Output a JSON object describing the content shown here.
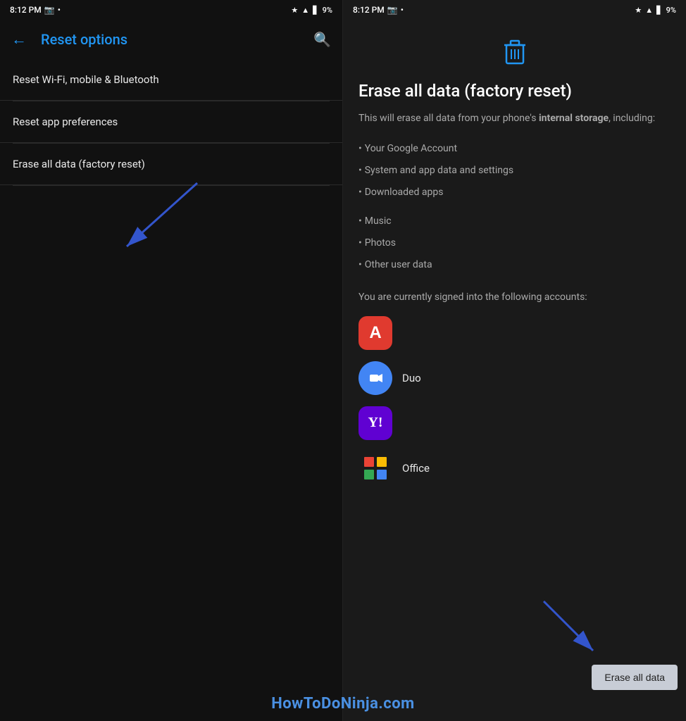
{
  "left_screen": {
    "status_bar": {
      "time": "8:12 PM",
      "battery": "9%"
    },
    "toolbar": {
      "back_label": "←",
      "title": "Reset options",
      "search_label": "🔍"
    },
    "menu_items": [
      {
        "id": "wifi-reset",
        "label": "Reset Wi-Fi, mobile & Bluetooth"
      },
      {
        "id": "app-prefs",
        "label": "Reset app preferences"
      },
      {
        "id": "factory-reset",
        "label": "Erase all data (factory reset)"
      }
    ]
  },
  "right_screen": {
    "status_bar": {
      "time": "8:12 PM",
      "battery": "9%"
    },
    "content": {
      "title": "Erase all data (factory reset)",
      "description_prefix": "This will erase all data from your phone's ",
      "description_bold": "internal storage",
      "description_suffix": ", including:",
      "bullet_items": [
        "Your Google Account",
        "System and app data and settings",
        "Downloaded apps",
        "Music",
        "Photos",
        "Other user data"
      ],
      "accounts_text": "You are currently signed into the following accounts:",
      "accounts": [
        {
          "id": "adobe",
          "name": ""
        },
        {
          "id": "duo",
          "name": "Duo"
        },
        {
          "id": "yahoo",
          "name": ""
        },
        {
          "id": "office",
          "name": "Office"
        }
      ],
      "erase_button_label": "Erase all data"
    }
  },
  "watermark": "HowToDoNinja.com"
}
